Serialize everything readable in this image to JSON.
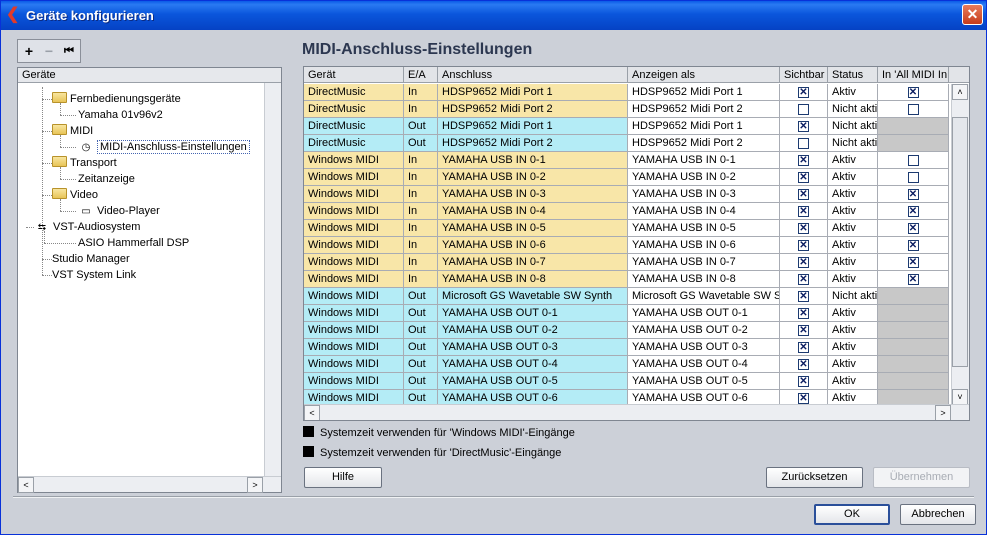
{
  "window": {
    "title": "Geräte konfigurieren"
  },
  "toolbar": {
    "add": "+",
    "remove": "−",
    "reset": "⏮"
  },
  "tree": {
    "header": "Geräte",
    "items": [
      {
        "label": "Fernbedienungsgeräte",
        "type": "folder"
      },
      {
        "label": "Yamaha 01v96v2",
        "type": "leaf"
      },
      {
        "label": "MIDI",
        "type": "folder"
      },
      {
        "label": "MIDI-Anschluss-Einstellungen",
        "type": "leaf-selected"
      },
      {
        "label": "Transport",
        "type": "folder"
      },
      {
        "label": "Zeitanzeige",
        "type": "leaf"
      },
      {
        "label": "Video",
        "type": "folder"
      },
      {
        "label": "Video-Player",
        "type": "leaf"
      },
      {
        "label": "VST-Audiosystem",
        "type": "root-icon"
      },
      {
        "label": "ASIO Hammerfall DSP",
        "type": "leaf"
      },
      {
        "label": "Studio Manager",
        "type": "root"
      },
      {
        "label": "VST System Link",
        "type": "root"
      }
    ]
  },
  "panel": {
    "title": "MIDI-Anschluss-Einstellungen"
  },
  "table": {
    "columns": [
      "Gerät",
      "E/A",
      "Anschluss",
      "Anzeigen als",
      "Sichtbar",
      "Status",
      "In 'All MIDI In"
    ],
    "rows": [
      {
        "device": "DirectMusic",
        "io": "In",
        "port": "HDSP9652 Midi Port 1",
        "display": "HDSP9652 Midi Port 1",
        "visible": true,
        "status": "Aktiv",
        "allmidi": "checked"
      },
      {
        "device": "DirectMusic",
        "io": "In",
        "port": "HDSP9652 Midi Port 2",
        "display": "HDSP9652 Midi Port 2",
        "visible": false,
        "status": "Nicht akti",
        "allmidi": "unchecked"
      },
      {
        "device": "DirectMusic",
        "io": "Out",
        "port": "HDSP9652 Midi Port 1",
        "display": "HDSP9652 Midi Port 1",
        "visible": true,
        "status": "Nicht akti",
        "allmidi": "none"
      },
      {
        "device": "DirectMusic",
        "io": "Out",
        "port": "HDSP9652 Midi Port 2",
        "display": "HDSP9652 Midi Port 2",
        "visible": false,
        "status": "Nicht akti",
        "allmidi": "none"
      },
      {
        "device": "Windows MIDI",
        "io": "In",
        "port": "YAMAHA USB IN 0-1",
        "display": "YAMAHA USB IN 0-1",
        "visible": true,
        "status": "Aktiv",
        "allmidi": "unchecked"
      },
      {
        "device": "Windows MIDI",
        "io": "In",
        "port": "YAMAHA USB IN 0-2",
        "display": "YAMAHA USB IN 0-2",
        "visible": true,
        "status": "Aktiv",
        "allmidi": "unchecked"
      },
      {
        "device": "Windows MIDI",
        "io": "In",
        "port": "YAMAHA USB IN 0-3",
        "display": "YAMAHA USB IN 0-3",
        "visible": true,
        "status": "Aktiv",
        "allmidi": "checked"
      },
      {
        "device": "Windows MIDI",
        "io": "In",
        "port": "YAMAHA USB IN 0-4",
        "display": "YAMAHA USB IN 0-4",
        "visible": true,
        "status": "Aktiv",
        "allmidi": "checked"
      },
      {
        "device": "Windows MIDI",
        "io": "In",
        "port": "YAMAHA USB IN 0-5",
        "display": "YAMAHA USB IN 0-5",
        "visible": true,
        "status": "Aktiv",
        "allmidi": "checked"
      },
      {
        "device": "Windows MIDI",
        "io": "In",
        "port": "YAMAHA USB IN 0-6",
        "display": "YAMAHA USB IN 0-6",
        "visible": true,
        "status": "Aktiv",
        "allmidi": "checked"
      },
      {
        "device": "Windows MIDI",
        "io": "In",
        "port": "YAMAHA USB IN 0-7",
        "display": "YAMAHA USB IN 0-7",
        "visible": true,
        "status": "Aktiv",
        "allmidi": "checked"
      },
      {
        "device": "Windows MIDI",
        "io": "In",
        "port": "YAMAHA USB IN 0-8",
        "display": "YAMAHA USB IN 0-8",
        "visible": true,
        "status": "Aktiv",
        "allmidi": "checked"
      },
      {
        "device": "Windows MIDI",
        "io": "Out",
        "port": "Microsoft GS Wavetable SW Synth",
        "display": "Microsoft GS Wavetable SW S",
        "visible": true,
        "status": "Nicht akti",
        "allmidi": "none"
      },
      {
        "device": "Windows MIDI",
        "io": "Out",
        "port": "YAMAHA USB OUT 0-1",
        "display": "YAMAHA USB OUT 0-1",
        "visible": true,
        "status": "Aktiv",
        "allmidi": "none"
      },
      {
        "device": "Windows MIDI",
        "io": "Out",
        "port": "YAMAHA USB OUT 0-2",
        "display": "YAMAHA USB OUT 0-2",
        "visible": true,
        "status": "Aktiv",
        "allmidi": "none"
      },
      {
        "device": "Windows MIDI",
        "io": "Out",
        "port": "YAMAHA USB OUT 0-3",
        "display": "YAMAHA USB OUT 0-3",
        "visible": true,
        "status": "Aktiv",
        "allmidi": "none"
      },
      {
        "device": "Windows MIDI",
        "io": "Out",
        "port": "YAMAHA USB OUT 0-4",
        "display": "YAMAHA USB OUT 0-4",
        "visible": true,
        "status": "Aktiv",
        "allmidi": "none"
      },
      {
        "device": "Windows MIDI",
        "io": "Out",
        "port": "YAMAHA USB OUT 0-5",
        "display": "YAMAHA USB OUT 0-5",
        "visible": true,
        "status": "Aktiv",
        "allmidi": "none"
      },
      {
        "device": "Windows MIDI",
        "io": "Out",
        "port": "YAMAHA USB OUT 0-6",
        "display": "YAMAHA USB OUT 0-6",
        "visible": true,
        "status": "Aktiv",
        "allmidi": "none"
      }
    ]
  },
  "options": {
    "windows_midi": "Systemzeit verwenden für 'Windows MIDI'-Eingänge",
    "directmusic": "Systemzeit verwenden für 'DirectMusic'-Eingänge"
  },
  "buttons": {
    "help": "Hilfe",
    "reset": "Zurücksetzen",
    "apply": "Übernehmen",
    "ok": "OK",
    "cancel": "Abbrechen"
  },
  "colors": {
    "in_row": "#f8e6a8",
    "out_row": "#b4ecf6",
    "disabled_cell": "#c8c8c8",
    "title_bar": "#0a56dc"
  }
}
